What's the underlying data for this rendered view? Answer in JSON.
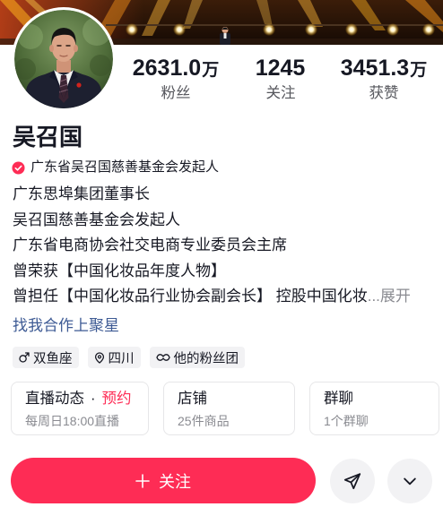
{
  "colors": {
    "accent": "#fe2c55",
    "text": "#161823",
    "secondary_text": "#8a8b91",
    "link": "#3d5a94",
    "tag_bg": "#f2f2f4",
    "card_border": "#e6e6e8",
    "icon_button_bg": "#f2f2f4"
  },
  "profile": {
    "name": "吴召国",
    "stats": [
      {
        "value": "2631.0",
        "unit": "万",
        "label": "粉丝"
      },
      {
        "value": "1245",
        "unit": "",
        "label": "关注"
      },
      {
        "value": "3451.3",
        "unit": "万",
        "label": "获赞"
      }
    ],
    "verification": {
      "icon": "verified-badge-icon",
      "text": "广东省吴召国慈善基金会发起人"
    },
    "bio": [
      "广东思埠集团董事长",
      "吴召国慈善基金会发起人",
      "广东省电商协会社交电商专业委员会主席",
      "曾荣获【中国化妆品年度人物】",
      "曾担任【中国化妆品行业协会副会长】 控股中国化妆"
    ],
    "bio_expand": "...展开",
    "link": "找我合作上聚星",
    "tags": [
      {
        "icon": "male-icon",
        "label": "双鱼座"
      },
      {
        "icon": "location-icon",
        "label": "四川"
      },
      {
        "icon": "fan-club-icon",
        "label": "他的粉丝团"
      }
    ]
  },
  "cards": [
    {
      "title": "直播动态",
      "separator": "·",
      "highlight": "预约",
      "subtitle": "每周日18:00直播"
    },
    {
      "title": "店铺",
      "subtitle": "25件商品"
    },
    {
      "title": "群聊",
      "subtitle": "1个群聊"
    }
  ],
  "actions": {
    "follow": {
      "icon": "plus-icon",
      "label": "关注"
    },
    "share": {
      "icon": "send-icon"
    },
    "more": {
      "icon": "chevron-down-icon"
    }
  }
}
